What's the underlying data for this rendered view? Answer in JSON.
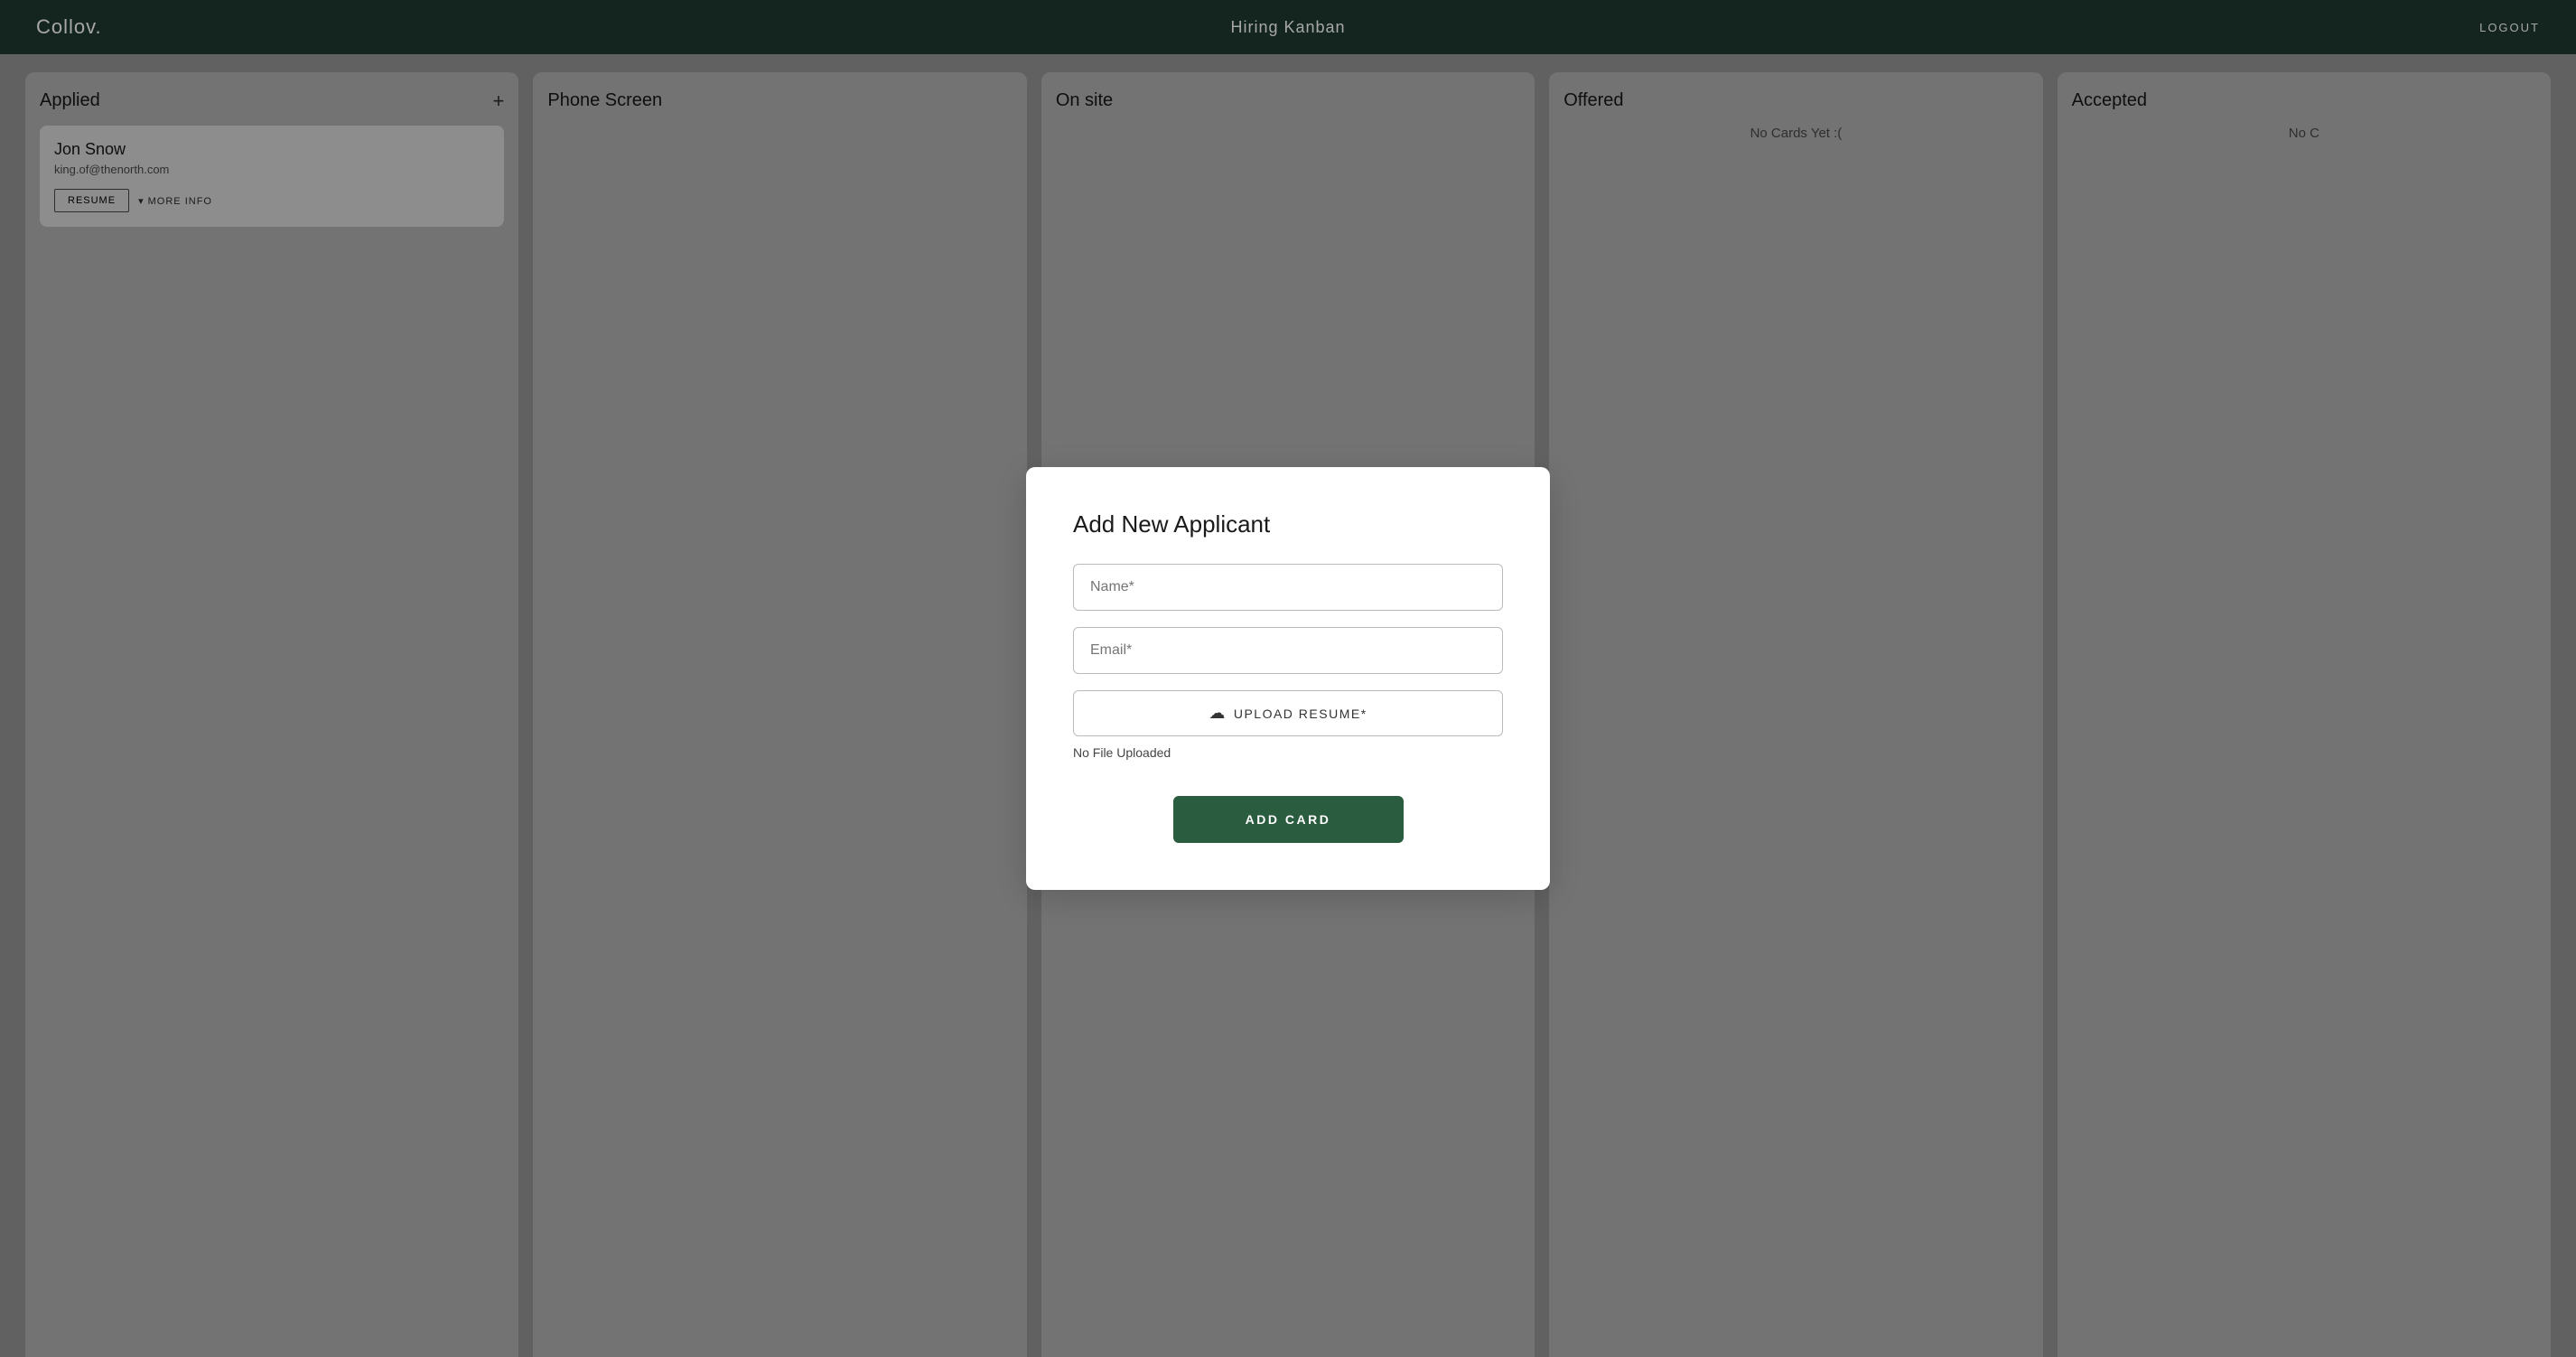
{
  "header": {
    "logo": "Collov.",
    "title": "Hiring Kanban",
    "logout_label": "LOGOUT"
  },
  "columns": [
    {
      "id": "applied",
      "title": "Applied",
      "has_add": true,
      "cards": [
        {
          "name": "Jon Snow",
          "email": "king.of@thenorth.com",
          "resume_label": "RESUME",
          "more_label": "MORE INFO"
        }
      ],
      "no_cards_text": ""
    },
    {
      "id": "phone-screen",
      "title": "Phone Screen",
      "has_add": false,
      "cards": [],
      "no_cards_text": ""
    },
    {
      "id": "on-site",
      "title": "On site",
      "has_add": false,
      "cards": [],
      "no_cards_text": ""
    },
    {
      "id": "offered",
      "title": "Offered",
      "has_add": false,
      "cards": [],
      "no_cards_text": "No Cards Yet :("
    },
    {
      "id": "accepted",
      "title": "Accepted",
      "has_add": false,
      "cards": [],
      "no_cards_text": "No C"
    }
  ],
  "modal": {
    "title": "Add New Applicant",
    "name_placeholder": "Name*",
    "email_placeholder": "Email*",
    "upload_label": "UPLOAD RESUME*",
    "no_file_text": "No File Uploaded",
    "add_card_label": "ADD CARD"
  }
}
